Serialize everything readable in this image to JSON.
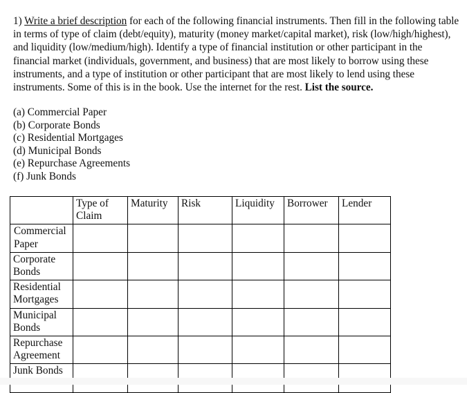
{
  "question": {
    "number": "1)",
    "underlined_lead": "Write a brief description",
    "body_part_1": " for each of the following financial instruments. Then fill in the following table in terms of type of claim (debt/equity), maturity (money market/capital market), risk (low/high/highest), and liquidity (low/medium/high). Identify a type of financial institution or other participant in the financial market (individuals, government, and business) that are most likely to borrow using these instruments, and a type of institution or other participant that are most likely to lend using these instruments. Some of this is in the book. Use the internet for the rest. ",
    "bold_tail": "List the source."
  },
  "instrument_list": [
    "(a) Commercial Paper",
    "(b) Corporate Bonds",
    "(c) Residential Mortgages",
    "(d) Municipal Bonds",
    "(e) Repurchase Agreements",
    "(f) Junk Bonds"
  ],
  "table": {
    "headers": [
      "",
      "Type of Claim",
      "Maturity",
      "Risk",
      "Liquidity",
      "Borrower",
      "Lender"
    ],
    "rows": [
      {
        "label": "Commercial\n Paper",
        "cells": [
          "",
          "",
          "",
          "",
          "",
          ""
        ]
      },
      {
        "label": "Corporate\nBonds",
        "cells": [
          "",
          "",
          "",
          "",
          "",
          ""
        ]
      },
      {
        "label": "Residential\nMortgages",
        "cells": [
          "",
          "",
          "",
          "",
          "",
          ""
        ]
      },
      {
        "label": "Municipal\nBonds",
        "cells": [
          "",
          "",
          "",
          "",
          "",
          ""
        ]
      },
      {
        "label": "Repurchase\nAgreement",
        "cells": [
          "",
          "",
          "",
          "",
          "",
          ""
        ]
      },
      {
        "label": "Junk Bonds",
        "cells": [
          "",
          "",
          "",
          "",
          "",
          ""
        ]
      }
    ]
  }
}
